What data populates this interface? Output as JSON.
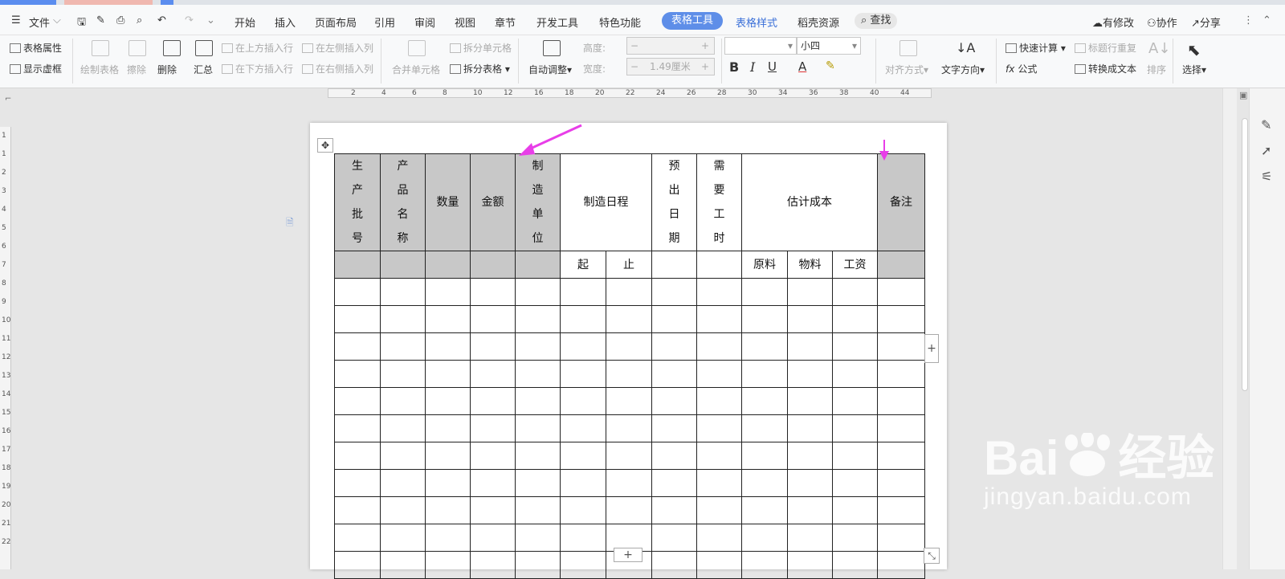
{
  "menubar": {
    "file": "文件",
    "tabs": [
      "开始",
      "插入",
      "页面布局",
      "引用",
      "审阅",
      "视图",
      "章节",
      "开发工具",
      "特色功能"
    ],
    "table_tools": "表格工具",
    "table_style": "表格样式",
    "shell_resources": "稻壳资源",
    "search": "查找",
    "modified": "有修改",
    "collaborate": "协作",
    "share": "分享"
  },
  "ribbon": {
    "table_props": "表格属性",
    "show_gridlines": "显示虚框",
    "draw_table": "绘制表格",
    "erase": "擦除",
    "delete": "删除",
    "summary": "汇总",
    "insert_above": "在上方插入行",
    "insert_below": "在下方插入行",
    "insert_left": "在左侧插入列",
    "insert_right": "在右侧插入列",
    "merge_cells": "合并单元格",
    "split_cells": "拆分单元格",
    "split_table": "拆分表格",
    "auto_fit": "自动调整",
    "height_label": "高度:",
    "width_label": "宽度:",
    "width_value": "1.49厘米",
    "font_size": "小四",
    "align": "对齐方式",
    "text_direction": "文字方向",
    "quick_calc": "快速计算",
    "repeat_header": "标题行重复",
    "formula": "公式",
    "to_text": "转换成文本",
    "sort": "排序",
    "select": "选择"
  },
  "ruler": {
    "h_ticks": [
      "2",
      "4",
      "6",
      "8",
      "10",
      "12",
      "16",
      "18",
      "20",
      "22",
      "24",
      "26",
      "28",
      "30",
      "34",
      "36",
      "38",
      "40",
      "44"
    ],
    "v_ticks": [
      "1",
      "1",
      "2",
      "3",
      "4",
      "5",
      "6",
      "7",
      "8",
      "9",
      "10",
      "11",
      "12",
      "13",
      "14",
      "15",
      "16",
      "17",
      "18",
      "19",
      "20",
      "21",
      "22"
    ]
  },
  "table": {
    "header1": [
      "生产批号",
      "产品名称",
      "数量",
      "金额",
      "制造单位",
      "制造日程",
      "预出日期",
      "需要工时",
      "估计成本",
      "备注"
    ],
    "header2": [
      "起",
      "止",
      "原料",
      "物料",
      "工资"
    ],
    "body_rows": 11
  },
  "watermark": {
    "brand": "Bai",
    "brand_cn": "经验",
    "url": "jingyan.baidu.com"
  },
  "colors": {
    "accent": "#5e8ee8",
    "header_fill": "#c8c8c8",
    "arrow": "#e83ee8"
  }
}
